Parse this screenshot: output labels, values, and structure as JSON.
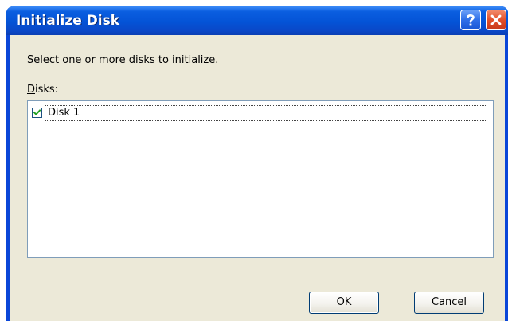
{
  "dialog": {
    "title": "Initialize Disk",
    "instruction": "Select one or more disks to initialize.",
    "disks_label_mnemonic": "D",
    "disks_label_rest": "isks:"
  },
  "disks": {
    "items": [
      {
        "label": "Disk 1",
        "checked": true
      }
    ]
  },
  "buttons": {
    "ok_label": "OK",
    "cancel_label": "Cancel"
  },
  "icons": {
    "help": "question-mark-icon",
    "close": "close-x-icon",
    "check": "checkmark-icon"
  },
  "colors": {
    "titlebar_accent": "#0453d6",
    "dialog_background": "#ece9d8",
    "close_button": "#e2502a",
    "list_border": "#7f9db9"
  }
}
